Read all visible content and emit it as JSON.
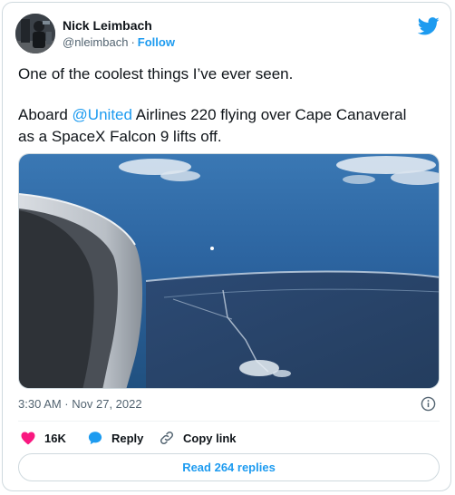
{
  "author": {
    "name": "Nick Leimbach",
    "handle": "@nleimbach",
    "separator": "·",
    "follow_label": "Follow"
  },
  "tweet": {
    "line1": "One of the coolest things I’ve ever seen.",
    "line2_prefix": "Aboard ",
    "mention": "@United",
    "line2_suffix": " Airlines 220 flying over Cape Canaveral",
    "line3": "as a SpaceX Falcon 9 lifts off."
  },
  "meta": {
    "timestamp": "3:30 AM · Nov 27, 2022"
  },
  "actions": {
    "like_count": "16K",
    "reply_label": "Reply",
    "copy_link_label": "Copy link"
  },
  "read_replies_label": "Read 264 replies",
  "colors": {
    "accent": "#1d9bf0",
    "like": "#f91880",
    "text": "#0f1419",
    "secondary": "#536471"
  }
}
